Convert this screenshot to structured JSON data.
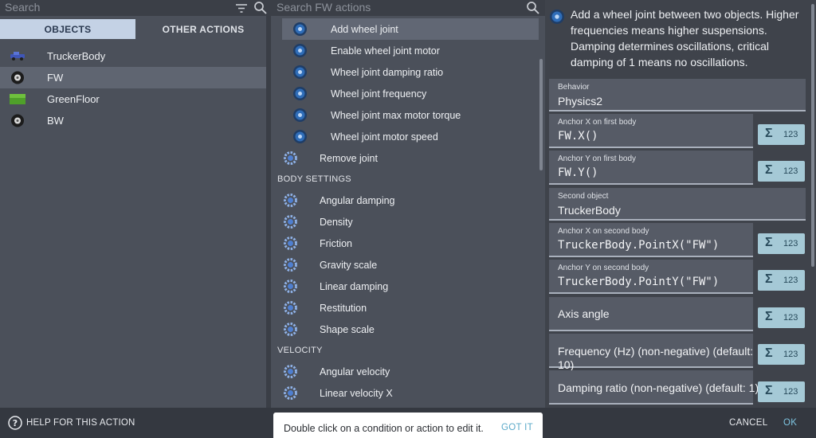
{
  "left": {
    "search_placeholder": "Search",
    "tabs": [
      "OBJECTS",
      "OTHER ACTIONS"
    ],
    "objects": [
      {
        "label": "TruckerBody",
        "icon": "truck-icon"
      },
      {
        "label": "FW",
        "icon": "wheel-icon"
      },
      {
        "label": "GreenFloor",
        "icon": "grass-floor-icon"
      },
      {
        "label": "BW",
        "icon": "wheel-icon"
      }
    ]
  },
  "middle": {
    "search_placeholder": "Search FW actions",
    "joint_actions": [
      "Add wheel joint",
      "Enable wheel joint motor",
      "Wheel joint damping ratio",
      "Wheel joint frequency",
      "Wheel joint max motor torque",
      "Wheel joint motor speed"
    ],
    "remove_joint": "Remove joint",
    "body_settings_header": "BODY SETTINGS",
    "body_settings": [
      "Angular damping",
      "Density",
      "Friction",
      "Gravity scale",
      "Linear damping",
      "Restitution",
      "Shape scale"
    ],
    "velocity_header": "VELOCITY",
    "velocity": [
      "Angular velocity",
      "Linear velocity X"
    ]
  },
  "right": {
    "description": "Add a wheel joint between two objects. Higher frequencies means higher suspensions. Damping determines oscillations, critical damping of 1 means no oscillations.",
    "fields": [
      {
        "label": "Behavior",
        "value": "Physics2"
      },
      {
        "label": "Anchor X on first body",
        "value": "FW.X()"
      },
      {
        "label": "Anchor Y on first body",
        "value": "FW.Y()"
      },
      {
        "label": "Second object",
        "value": "TruckerBody"
      },
      {
        "label": "Anchor X on second body",
        "value": "TruckerBody.PointX(\"FW\")"
      },
      {
        "label": "Anchor Y on second body",
        "value": "TruckerBody.PointY(\"FW\")"
      },
      {
        "label": "",
        "value": "Axis angle"
      },
      {
        "label": "",
        "value": "Frequency (Hz) (non-negative) (default: 10)"
      },
      {
        "label": "",
        "value": "Damping ratio (non-negative) (default: 1)"
      }
    ],
    "expr_button": {
      "sigma": "Σ",
      "num": "123"
    }
  },
  "bottom": {
    "help": "HELP FOR THIS ACTION",
    "cancel": "CANCEL",
    "ok": "OK"
  },
  "snackbar": {
    "message": "Double click on a condition or action to edit it.",
    "button": "GOT IT"
  }
}
